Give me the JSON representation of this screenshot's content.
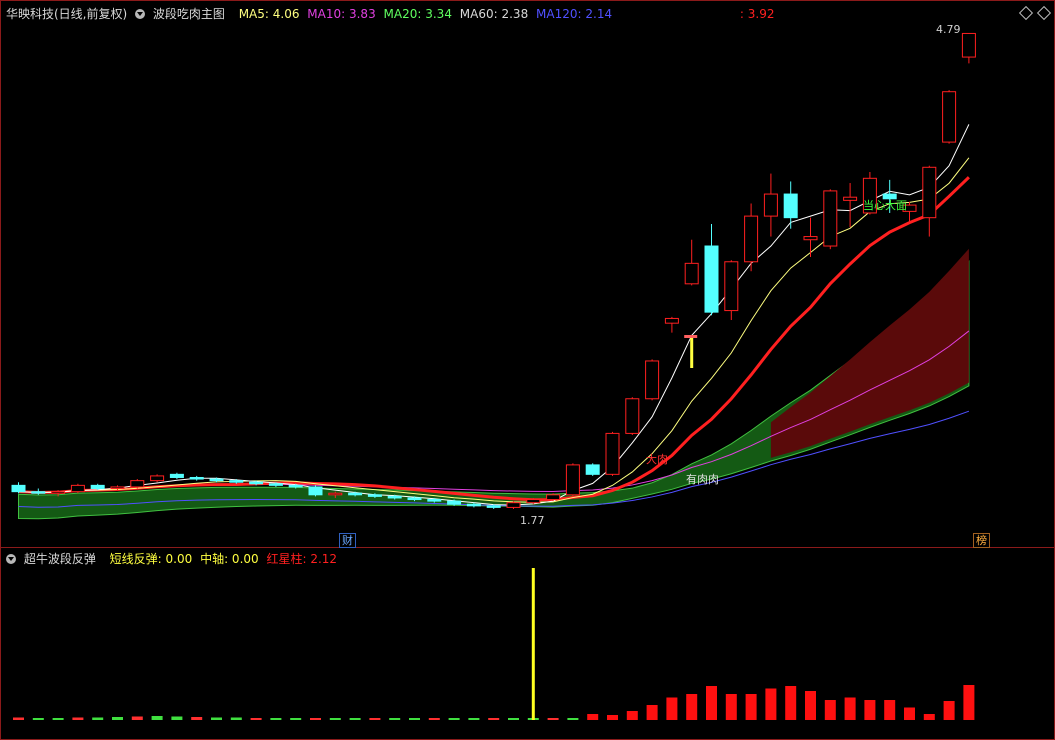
{
  "header": {
    "stock": "华映科技(日线,前复权)",
    "indicator_main": "波段吃肉主图",
    "ma5": "MA5: 4.06",
    "ma10": "MA10: 3.83",
    "ma20": "MA20: 3.34",
    "ma60": "MA60: 2.38",
    "ma120": "MA120: 2.14",
    "extra": ": 3.92"
  },
  "sub_header": {
    "indicator": "超牛波段反弹",
    "short_rebound": "短线反弹: 0.00",
    "mid_axis": "中轴: 0.00",
    "red_star": "红星柱: 2.12"
  },
  "labels": {
    "high": "4.79",
    "low": "1.77",
    "big_meat": "大肉",
    "has_meat": "有肉肉",
    "careful_top": "当心大面",
    "cai_tag": "财",
    "bang_tag": "榜"
  },
  "colors": {
    "up": "#ff2020",
    "down": "#54ffff",
    "ma5": "#ffffff",
    "ma10": "#ffff80",
    "ma20": "#ff2020",
    "ma60": "#e040e0",
    "ma120": "#5050ff"
  },
  "chart_data": {
    "type": "candlestick",
    "candles": [
      {
        "o": 1.92,
        "h": 1.94,
        "l": 1.87,
        "c": 1.88
      },
      {
        "o": 1.88,
        "h": 1.9,
        "l": 1.86,
        "c": 1.87
      },
      {
        "o": 1.87,
        "h": 1.89,
        "l": 1.85,
        "c": 1.88
      },
      {
        "o": 1.88,
        "h": 1.93,
        "l": 1.87,
        "c": 1.92
      },
      {
        "o": 1.92,
        "h": 1.93,
        "l": 1.89,
        "c": 1.9
      },
      {
        "o": 1.9,
        "h": 1.92,
        "l": 1.89,
        "c": 1.91
      },
      {
        "o": 1.91,
        "h": 1.96,
        "l": 1.9,
        "c": 1.95
      },
      {
        "o": 1.95,
        "h": 1.99,
        "l": 1.94,
        "c": 1.98
      },
      {
        "o": 1.99,
        "h": 2.0,
        "l": 1.96,
        "c": 1.97
      },
      {
        "o": 1.97,
        "h": 1.98,
        "l": 1.95,
        "c": 1.96
      },
      {
        "o": 1.96,
        "h": 1.97,
        "l": 1.94,
        "c": 1.95
      },
      {
        "o": 1.95,
        "h": 1.96,
        "l": 1.93,
        "c": 1.94
      },
      {
        "o": 1.94,
        "h": 1.95,
        "l": 1.92,
        "c": 1.93
      },
      {
        "o": 1.93,
        "h": 1.94,
        "l": 1.91,
        "c": 1.92
      },
      {
        "o": 1.92,
        "h": 1.93,
        "l": 1.9,
        "c": 1.91
      },
      {
        "o": 1.91,
        "h": 1.92,
        "l": 1.85,
        "c": 1.86
      },
      {
        "o": 1.86,
        "h": 1.88,
        "l": 1.84,
        "c": 1.87
      },
      {
        "o": 1.87,
        "h": 1.88,
        "l": 1.85,
        "c": 1.86
      },
      {
        "o": 1.86,
        "h": 1.87,
        "l": 1.84,
        "c": 1.85
      },
      {
        "o": 1.85,
        "h": 1.86,
        "l": 1.83,
        "c": 1.84
      },
      {
        "o": 1.84,
        "h": 1.85,
        "l": 1.82,
        "c": 1.83
      },
      {
        "o": 1.83,
        "h": 1.84,
        "l": 1.81,
        "c": 1.82
      },
      {
        "o": 1.82,
        "h": 1.83,
        "l": 1.79,
        "c": 1.8
      },
      {
        "o": 1.8,
        "h": 1.81,
        "l": 1.78,
        "c": 1.79
      },
      {
        "o": 1.79,
        "h": 1.8,
        "l": 1.77,
        "c": 1.78
      },
      {
        "o": 1.78,
        "h": 1.82,
        "l": 1.77,
        "c": 1.81
      },
      {
        "o": 1.81,
        "h": 1.84,
        "l": 1.8,
        "c": 1.83
      },
      {
        "o": 1.83,
        "h": 1.87,
        "l": 1.82,
        "c": 1.86
      },
      {
        "o": 1.86,
        "h": 2.06,
        "l": 1.85,
        "c": 2.05
      },
      {
        "o": 2.05,
        "h": 2.06,
        "l": 1.98,
        "c": 1.99
      },
      {
        "o": 1.99,
        "h": 2.26,
        "l": 1.98,
        "c": 2.25
      },
      {
        "o": 2.25,
        "h": 2.48,
        "l": 2.24,
        "c": 2.47
      },
      {
        "o": 2.47,
        "h": 2.72,
        "l": 2.46,
        "c": 2.71
      },
      {
        "o": 2.95,
        "h": 2.99,
        "l": 2.89,
        "c": 2.98
      },
      {
        "o": 3.2,
        "h": 3.48,
        "l": 3.19,
        "c": 3.33
      },
      {
        "o": 3.44,
        "h": 3.58,
        "l": 3.0,
        "c": 3.02
      },
      {
        "o": 3.03,
        "h": 3.35,
        "l": 2.97,
        "c": 3.34
      },
      {
        "o": 3.34,
        "h": 3.71,
        "l": 3.28,
        "c": 3.63
      },
      {
        "o": 3.63,
        "h": 3.9,
        "l": 3.5,
        "c": 3.77
      },
      {
        "o": 3.77,
        "h": 3.85,
        "l": 3.55,
        "c": 3.62
      },
      {
        "o": 3.48,
        "h": 3.62,
        "l": 3.37,
        "c": 3.5
      },
      {
        "o": 3.44,
        "h": 3.8,
        "l": 3.42,
        "c": 3.79
      },
      {
        "o": 3.73,
        "h": 3.84,
        "l": 3.56,
        "c": 3.75
      },
      {
        "o": 3.65,
        "h": 3.91,
        "l": 3.64,
        "c": 3.87
      },
      {
        "o": 3.77,
        "h": 3.86,
        "l": 3.65,
        "c": 3.74
      },
      {
        "o": 3.66,
        "h": 3.72,
        "l": 3.58,
        "c": 3.7
      },
      {
        "o": 3.62,
        "h": 3.95,
        "l": 3.5,
        "c": 3.94
      },
      {
        "o": 4.1,
        "h": 4.43,
        "l": 4.09,
        "c": 4.42
      },
      {
        "o": 4.64,
        "h": 4.79,
        "l": 4.6,
        "c": 4.79
      }
    ],
    "ylim": [
      1.7,
      4.85
    ],
    "sub_chart": {
      "type": "bar",
      "values": [
        0.05,
        0.04,
        0.04,
        0.05,
        0.05,
        0.06,
        0.07,
        0.08,
        0.07,
        0.06,
        0.05,
        0.05,
        0.04,
        0.04,
        0.04,
        0.04,
        0.04,
        0.04,
        0.04,
        0.04,
        0.04,
        0.04,
        0.04,
        0.04,
        0.04,
        0.04,
        0.04,
        0.04,
        0.04,
        0.12,
        0.1,
        0.18,
        0.3,
        0.45,
        0.52,
        0.68,
        0.52,
        0.52,
        0.63,
        0.68,
        0.58,
        0.4,
        0.45,
        0.4,
        0.4,
        0.25,
        0.12,
        0.38,
        0.7
      ],
      "yellow_index": 26
    }
  }
}
